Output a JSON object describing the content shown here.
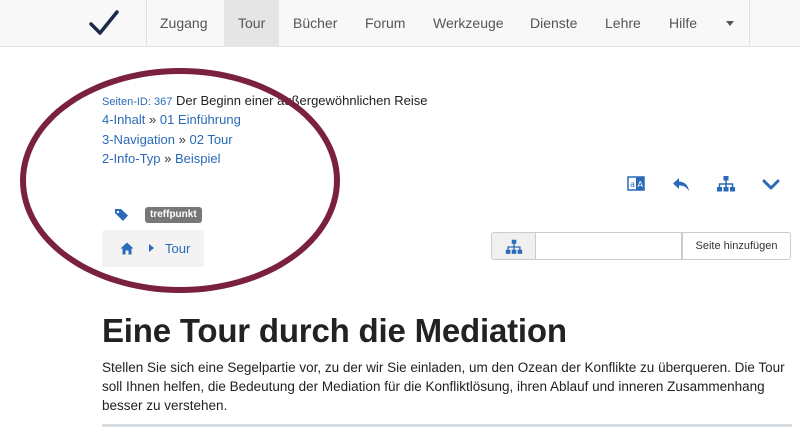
{
  "nav": {
    "items": [
      "Zugang",
      "Tour",
      "Bücher",
      "Forum",
      "Werkzeuge",
      "Dienste",
      "Lehre",
      "Hilfe"
    ],
    "active": "Tour"
  },
  "meta": {
    "page_id_label": "Seiten-ID: 367",
    "page_title": "Der Beginn einer außergewöhnlichen Reise",
    "rows": [
      {
        "key": "4-Inhalt",
        "sep": "»",
        "value": "01 Einführung"
      },
      {
        "key": "3-Navigation",
        "sep": "»",
        "value": "02 Tour"
      },
      {
        "key": "2-Info-Typ",
        "sep": "»",
        "value": "Beispiel"
      }
    ]
  },
  "tags": [
    "treffpunkt"
  ],
  "breadcrumb": {
    "current": "Tour"
  },
  "page_add": {
    "placeholder": "",
    "button_label": "Seite hinzufügen"
  },
  "main": {
    "heading": "Eine Tour durch die Mediation",
    "intro": "Stellen Sie sich eine Segelpartie vor, zu der wir Sie einladen, um den Ozean der Konflikte zu überqueren. Die Tour soll Ihnen helfen, die Bedeutung der Mediation für die Konfliktlösung, ihren Ablauf und inneren Zusammenhang besser zu verstehen."
  },
  "icons": {
    "logo": "checkmark-logo",
    "toolbar": [
      "translate-icon",
      "reply-icon",
      "sitemap-icon",
      "chevron-down-icon"
    ]
  },
  "colors": {
    "link": "#2a6ab8",
    "circle_annotation": "#7a2040",
    "logo": "#1c2a4a"
  }
}
